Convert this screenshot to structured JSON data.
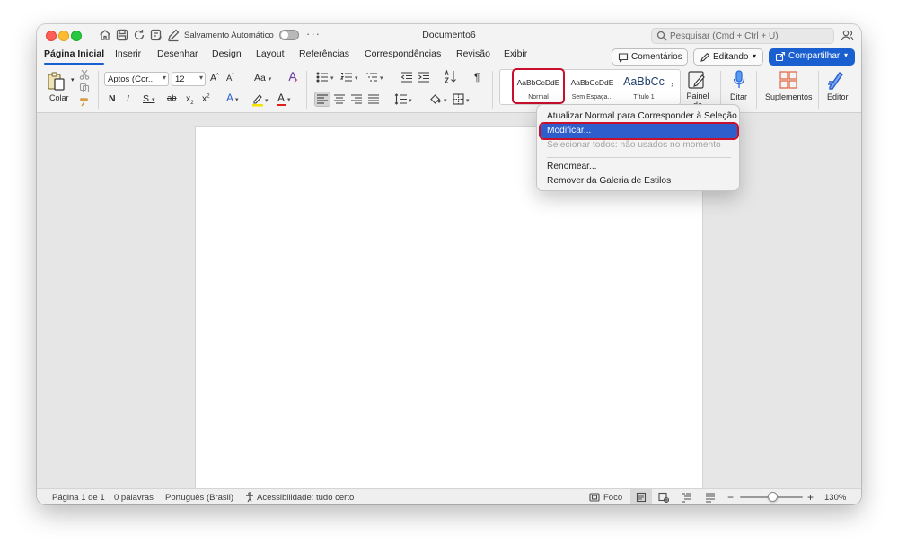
{
  "titlebar": {
    "autosave_label": "Salvamento Automático",
    "more": "···",
    "doc_title": "Documento6",
    "search_placeholder": "Pesquisar (Cmd + Ctrl + U)"
  },
  "tabs": [
    {
      "label": "Página Inicial",
      "active": true
    },
    {
      "label": "Inserir"
    },
    {
      "label": "Desenhar"
    },
    {
      "label": "Design"
    },
    {
      "label": "Layout"
    },
    {
      "label": "Referências"
    },
    {
      "label": "Correspondências"
    },
    {
      "label": "Revisão"
    },
    {
      "label": "Exibir"
    }
  ],
  "header_buttons": {
    "comments": "Comentários",
    "editing": "Editando",
    "share": "Compartilhar"
  },
  "ribbon": {
    "paste_label": "Colar",
    "font_name": "Aptos (Cor...",
    "font_size": "12",
    "grow": "A",
    "shrink": "A",
    "case": "Aa",
    "bold": "N",
    "italic": "I",
    "underline": "S",
    "strike": "ab",
    "subscript": "x",
    "superscript": "x",
    "text_effects": "A",
    "font_color": "A",
    "pilcrow": "¶",
    "styles": [
      {
        "sample": "AaBbCcDdE",
        "name": "Normal",
        "selected": true
      },
      {
        "sample": "AaBbCcDdE",
        "name": "Sem Espaça..."
      },
      {
        "sample": "AaBbCc",
        "name": "Título 1"
      }
    ],
    "styles_pane_label": "Painel de Estilos",
    "dictate_label": "Ditar",
    "addins_label": "Suplementos",
    "editor_label": "Editor"
  },
  "context_menu": {
    "items": [
      {
        "label": "Atualizar Normal para Corresponder à Seleção"
      },
      {
        "label": "Modificar...",
        "highlighted": true
      },
      {
        "label": "Selecionar todos: não usados no momento",
        "disabled": true
      },
      {
        "label": "Renomear..."
      },
      {
        "label": "Remover da Galeria de Estilos"
      }
    ]
  },
  "statusbar": {
    "page": "Página 1 de 1",
    "words": "0 palavras",
    "language": "Português (Brasil)",
    "accessibility": "Acessibilidade: tudo certo",
    "focus": "Foco",
    "zoom_minus": "−",
    "zoom_plus": "+",
    "zoom_level": "130%"
  },
  "colors": {
    "accent": "#1a5fd0",
    "highlight_outline": "#c8102e",
    "menu_selection": "#2e5ecb",
    "highlighter": "#f5e400",
    "font_color_bar": "#e0201b"
  },
  "icons": [
    "home-icon",
    "save-icon",
    "redo-icon",
    "autosave-icon",
    "pen-icon",
    "search-icon",
    "profile-icon",
    "comment-icon",
    "pencil-icon",
    "share-icon",
    "paste-icon",
    "cut-icon",
    "copy-icon",
    "format-painter-icon",
    "clear-format-icon",
    "bullets-icon",
    "numbering-icon",
    "multilevel-icon",
    "outdent-icon",
    "indent-icon",
    "sort-icon",
    "pilcrow-icon",
    "align-left-icon",
    "align-center-icon",
    "align-right-icon",
    "justify-icon",
    "line-spacing-icon",
    "shading-icon",
    "borders-icon",
    "styles-pane-icon",
    "microphone-icon",
    "addins-icon",
    "editor-icon",
    "focus-icon",
    "accessibility-icon"
  ]
}
